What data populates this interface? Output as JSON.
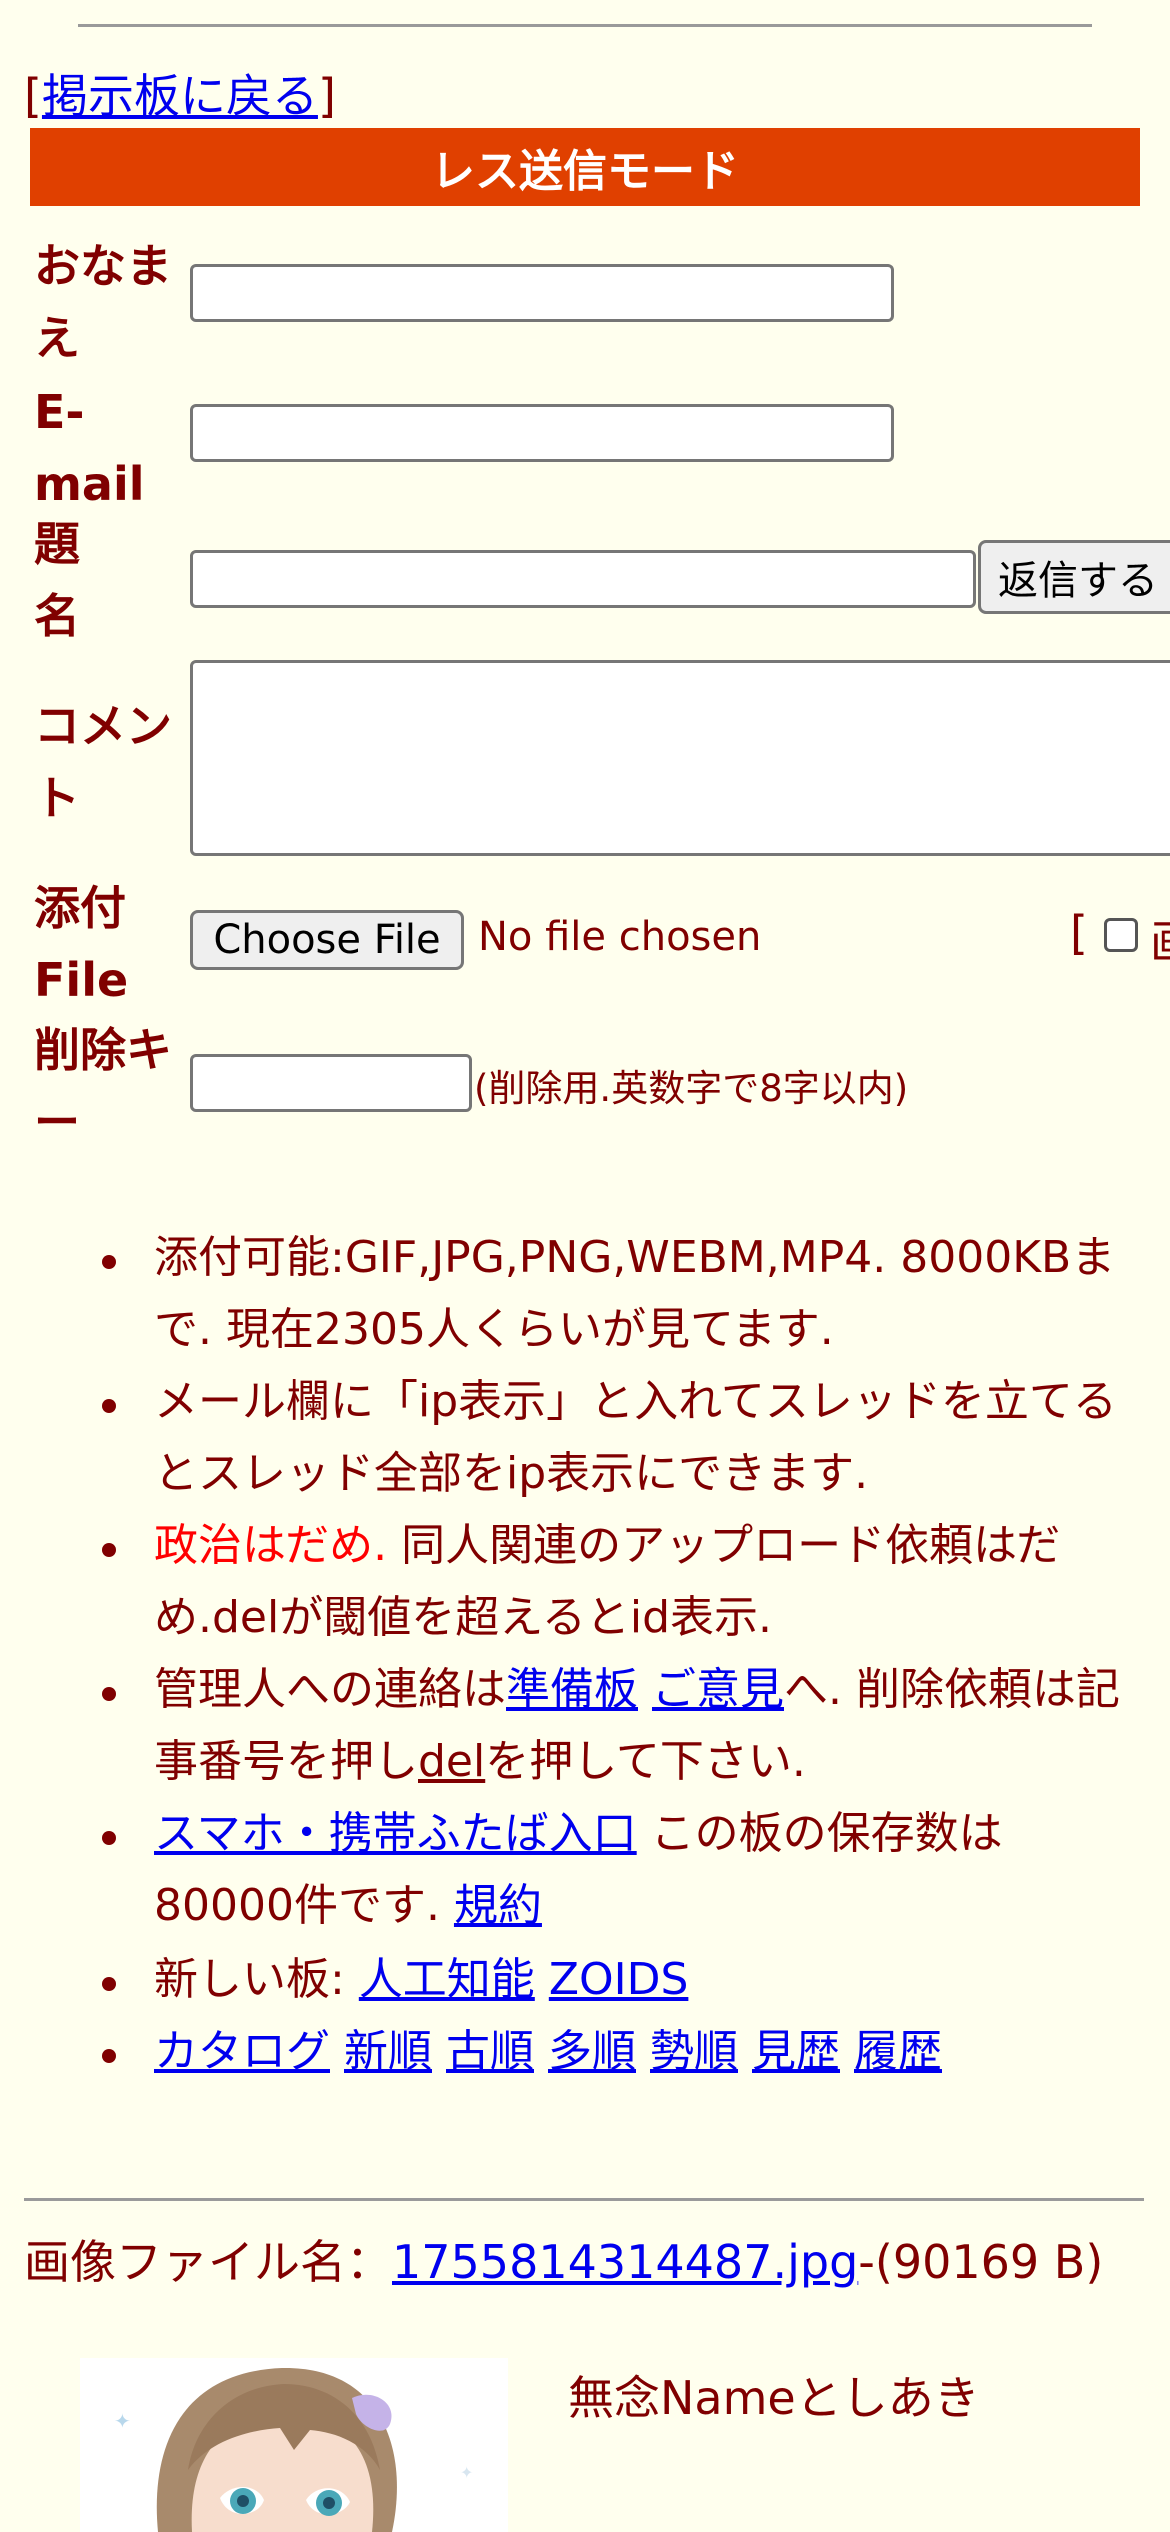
{
  "nav": {
    "back_bracket_open": "[",
    "back_link": "掲示板に戻る",
    "back_bracket_close": "]"
  },
  "mode_title": "レス送信モード",
  "form": {
    "name_label": "おなまえ",
    "email_label": "E-mail",
    "subject_label": "題名",
    "submit_button": "返信する",
    "comment_label": "コメント",
    "file_label": "添付File",
    "choose_file_button": "Choose File",
    "no_file_text": "No file chosen",
    "image_option_bracket": "[",
    "image_option_truncated": "画",
    "delete_key_label": "削除キー",
    "delete_key_note": "(削除用.英数字で8字以内)"
  },
  "notes": {
    "n1": "添付可能:GIF,JPG,PNG,WEBM,MP4. 8000KBまで. 現在2305人くらいが見てます.",
    "n2": "メール欄に「ip表示」と入れてスレッドを立てるとスレッド全部をip表示にできます.",
    "n3_red": "政治はだめ.",
    "n3_rest": " 同人関連のアップロード依頼はだめ.delが閾値を超えるとid表示.",
    "n4_prefix": "管理人への連絡は",
    "n4_link1": "準備板",
    "n4_link2": "ご意見",
    "n4_mid": "へ. 削除依頼は記事番号を押し",
    "n4_link3": "del",
    "n4_suffix": "を押して下さい.",
    "n5_link": "スマホ・携帯ふたば入口",
    "n5_mid": " この板の保存数は80000件です. ",
    "n5_link2": "規約",
    "n6_prefix": "新しい板: ",
    "n6_link1": "人工知能",
    "n6_link2": "ZOIDS",
    "n7_links": [
      "カタログ",
      "新順",
      "古順",
      "多順",
      "勢順",
      "見歴",
      "履歴"
    ]
  },
  "post": {
    "file_prefix": "画像ファイル名：",
    "file_link": "1755814314487.jpg",
    "file_size": "-(90169 B)",
    "poster_text": "無念Nameとしあき"
  },
  "colors": {
    "background": "#ffffee",
    "text": "#800000",
    "mode_bar": "#e04000",
    "link": "#0000ee",
    "warning": "#ff0000"
  }
}
